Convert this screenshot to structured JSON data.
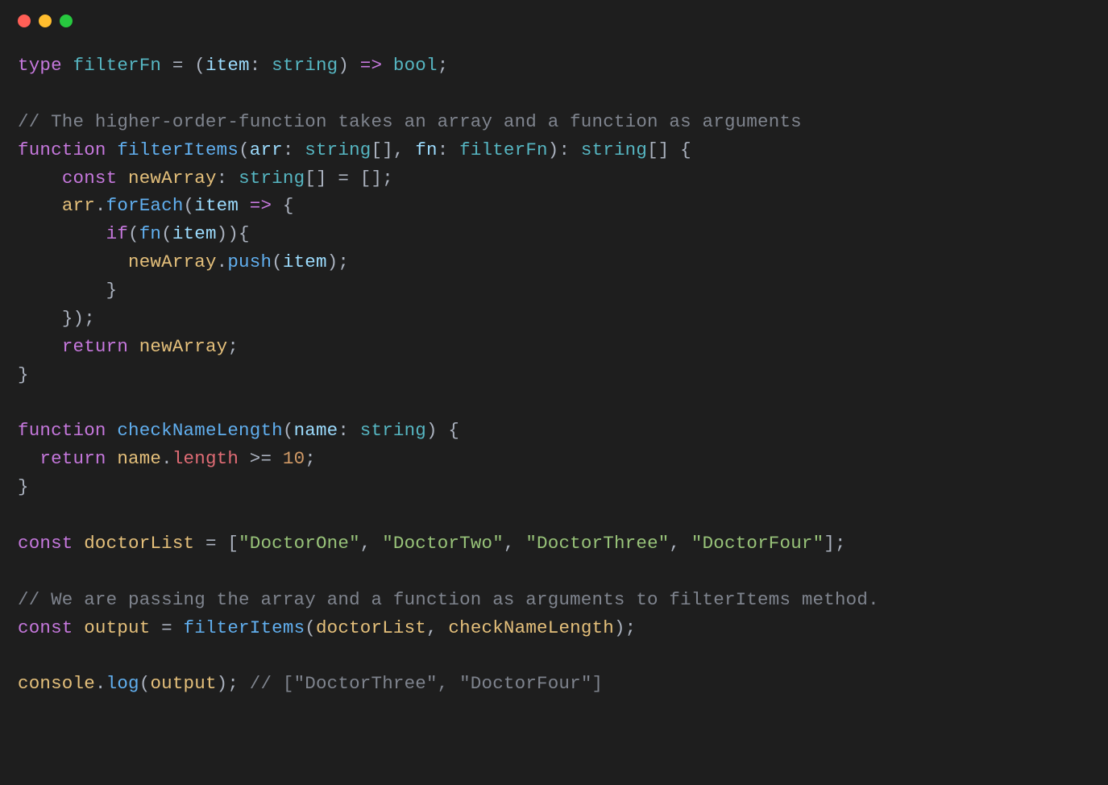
{
  "traffic_lights": {
    "red": "#ff5f56",
    "yellow": "#ffbd2e",
    "green": "#27c93f"
  },
  "code": {
    "l1": {
      "kw_type": "type",
      "name": "filterFn",
      "eq": " = (",
      "param": "item",
      "colon": ": ",
      "ptype": "string",
      "close": ") ",
      "arrow": "=>",
      "sp": " ",
      "ret": "bool",
      "semi": ";"
    },
    "l2": {
      "comment": "// The higher-order-function takes an array and a function as arguments"
    },
    "l3": {
      "kw_fn": "function",
      "name": "filterItems",
      "open": "(",
      "p1": "arr",
      "c1": ": ",
      "t1": "string",
      "br1": "[], ",
      "p2": "fn",
      "c2": ": ",
      "t2": "filterFn",
      "close": "): ",
      "rt": "string",
      "br2": "[] {"
    },
    "l4": {
      "indent": "    ",
      "kw_const": "const",
      "sp": " ",
      "name": "newArray",
      "colon": ": ",
      "type": "string",
      "rest": "[] = [];"
    },
    "l5": {
      "indent": "    ",
      "obj": "arr",
      "dot": ".",
      "method": "forEach",
      "open": "(",
      "param": "item",
      "sp": " ",
      "arrow": "=>",
      "brace": " {"
    },
    "l6": {
      "indent": "        ",
      "kw_if": "if",
      "open": "(",
      "fn": "fn",
      "po": "(",
      "arg": "item",
      "close": ")){",
      "ws": ""
    },
    "l7": {
      "indent": "          ",
      "obj": "newArray",
      "dot": ".",
      "method": "push",
      "open": "(",
      "arg": "item",
      "close": ");"
    },
    "l8": {
      "indent": "        ",
      "brace": "}"
    },
    "l9": {
      "indent": "    ",
      "close": "});"
    },
    "l10": {
      "indent": "    ",
      "kw_return": "return",
      "sp": " ",
      "name": "newArray",
      "semi": ";"
    },
    "l11": {
      "brace": "}"
    },
    "l12": {
      "kw_fn": "function",
      "name": "checkNameLength",
      "open": "(",
      "param": "name",
      "colon": ": ",
      "type": "string",
      "close": ") {"
    },
    "l13": {
      "indent": "  ",
      "kw_return": "return",
      "sp": " ",
      "obj": "name",
      "dot": ".",
      "prop": "length",
      "sp2": " ",
      "op": ">=",
      "sp3": " ",
      "num": "10",
      "semi": ";"
    },
    "l14": {
      "brace": "}"
    },
    "l15": {
      "kw_const": "const",
      "sp": " ",
      "name": "doctorList",
      "eq": " = [",
      "s1": "\"DoctorOne\"",
      "c1": ", ",
      "s2": "\"DoctorTwo\"",
      "c2": ", ",
      "s3": "\"DoctorThree\"",
      "c3": ", ",
      "s4": "\"DoctorFour\"",
      "close": "];"
    },
    "l16": {
      "comment": "// We are passing the array and a function as arguments to filterItems method."
    },
    "l17": {
      "kw_const": "const",
      "sp": " ",
      "name": "output",
      "eq": " = ",
      "fn": "filterItems",
      "open": "(",
      "a1": "doctorList",
      "comma": ", ",
      "a2": "checkNameLength",
      "close": ");"
    },
    "l18": {
      "obj": "console",
      "dot": ".",
      "method": "log",
      "open": "(",
      "arg": "output",
      "close": "); ",
      "comment": "// [\"DoctorThree\", \"DoctorFour\"]"
    }
  }
}
